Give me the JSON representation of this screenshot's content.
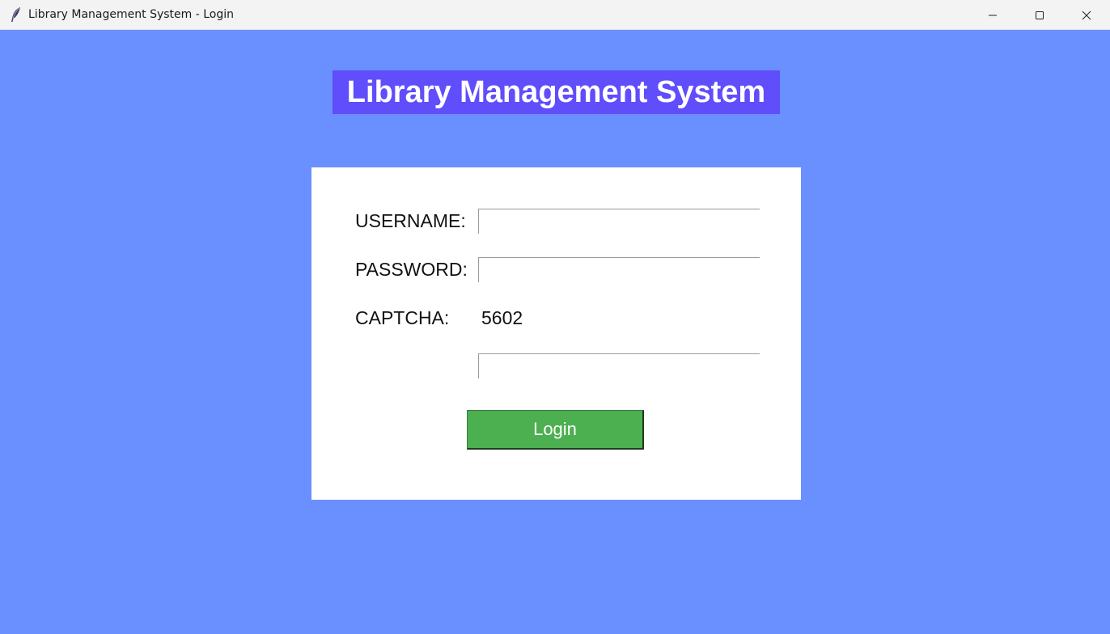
{
  "window": {
    "title": "Library Management System - Login",
    "icon": "feather-icon",
    "controls": [
      "minimize-icon",
      "maximize-icon",
      "close-icon"
    ]
  },
  "colors": {
    "background": "#6a8fff",
    "heading_bg": "#604dfb",
    "panel_bg": "#ffffff",
    "login_button": "#4caf50"
  },
  "heading": {
    "text": "Library Management System"
  },
  "form": {
    "username_label": "USERNAME:",
    "username_value": "",
    "password_label": "PASSWORD:",
    "password_value": "",
    "captcha_label": "CAPTCHA:",
    "captcha_code": "5602",
    "captcha_input_value": "",
    "login_label": "Login"
  }
}
